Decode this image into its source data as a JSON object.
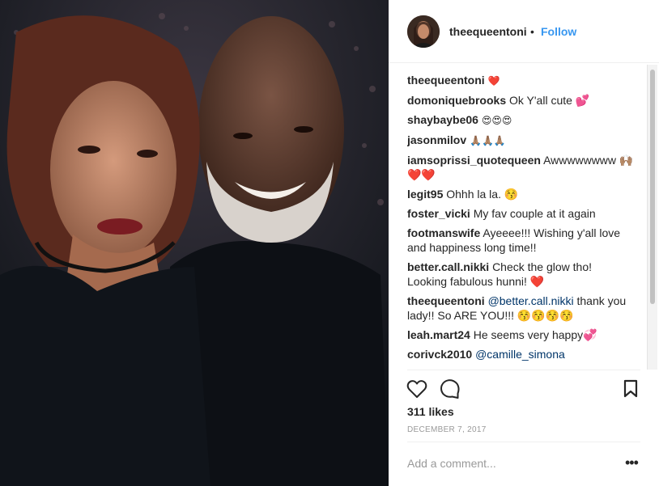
{
  "post": {
    "username": "theequeentoni",
    "separator": "•",
    "follow_label": "Follow",
    "likes_text": "311 likes",
    "date_text": "DECEMBER 7, 2017",
    "add_comment_placeholder": "Add a comment...",
    "more_label": "•••"
  },
  "comments": [
    {
      "user": "theequeentoni",
      "text": "❤️"
    },
    {
      "user": "domoniquebrooks",
      "text": "Ok Y'all cute 💕"
    },
    {
      "user": "shaybaybe06",
      "text": "😍😍😍"
    },
    {
      "user": "jasonmilov",
      "text": "🙏🏽🙏🏽🙏🏽"
    },
    {
      "user": "iamsoprissi_quotequeen",
      "text": "Awwwwwwww 🙌🏽❤️❤️"
    },
    {
      "user": "legit95",
      "text": "Ohhh la la. 😚"
    },
    {
      "user": "foster_vicki",
      "text": "My fav couple at it again"
    },
    {
      "user": "footmanswife",
      "text": "Ayeeee!!! Wishing y'all love and happiness long time!!"
    },
    {
      "user": "better.call.nikki",
      "text": "Check the glow tho! Looking fabulous hunni! ❤️"
    },
    {
      "user": "theequeentoni",
      "mention": "@better.call.nikki",
      "text": "thank you lady!! So ARE YOU!!! 😚😚😚😚"
    },
    {
      "user": "leah.mart24",
      "text": "He seems very happy💞"
    },
    {
      "user": "corivck2010",
      "mention": "@camille_simona",
      "text": ""
    }
  ],
  "icons": {
    "like": "heart-outline-icon",
    "comment": "speech-bubble-icon",
    "save": "bookmark-icon"
  },
  "colors": {
    "link_blue": "#3897f0",
    "mention_blue": "#003569",
    "muted_gray": "#999999",
    "text": "#262626"
  }
}
